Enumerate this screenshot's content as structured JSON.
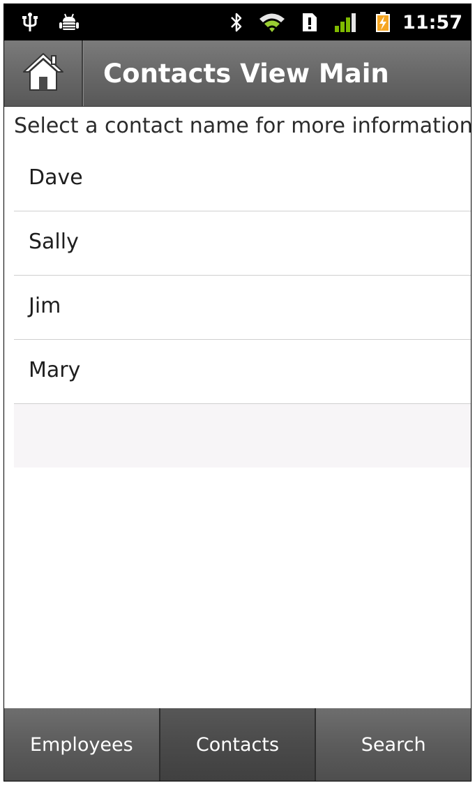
{
  "status_bar": {
    "time": "11:57",
    "icons": [
      "usb-icon",
      "android-debug-icon",
      "bluetooth-icon",
      "wifi-icon",
      "sd-card-alert-icon",
      "signal-icon",
      "battery-charging-icon"
    ]
  },
  "title_bar": {
    "home_icon": "home-icon",
    "title": "Contacts View Main"
  },
  "content": {
    "instruction": "Select a contact name for more information",
    "contacts": [
      "Dave",
      "Sally",
      "Jim",
      "Mary"
    ]
  },
  "tabs": [
    {
      "label": "Employees",
      "active": false
    },
    {
      "label": "Contacts",
      "active": true
    },
    {
      "label": "Search",
      "active": false
    }
  ],
  "colors": {
    "status_bar_bg": "#000000",
    "wifi_accent": "#9acd32",
    "signal_accent": "#7fba00",
    "battery_accent": "#f5a623",
    "title_bar_bg": "#6a6a6a",
    "tab_bg": "#5c5c5c"
  }
}
